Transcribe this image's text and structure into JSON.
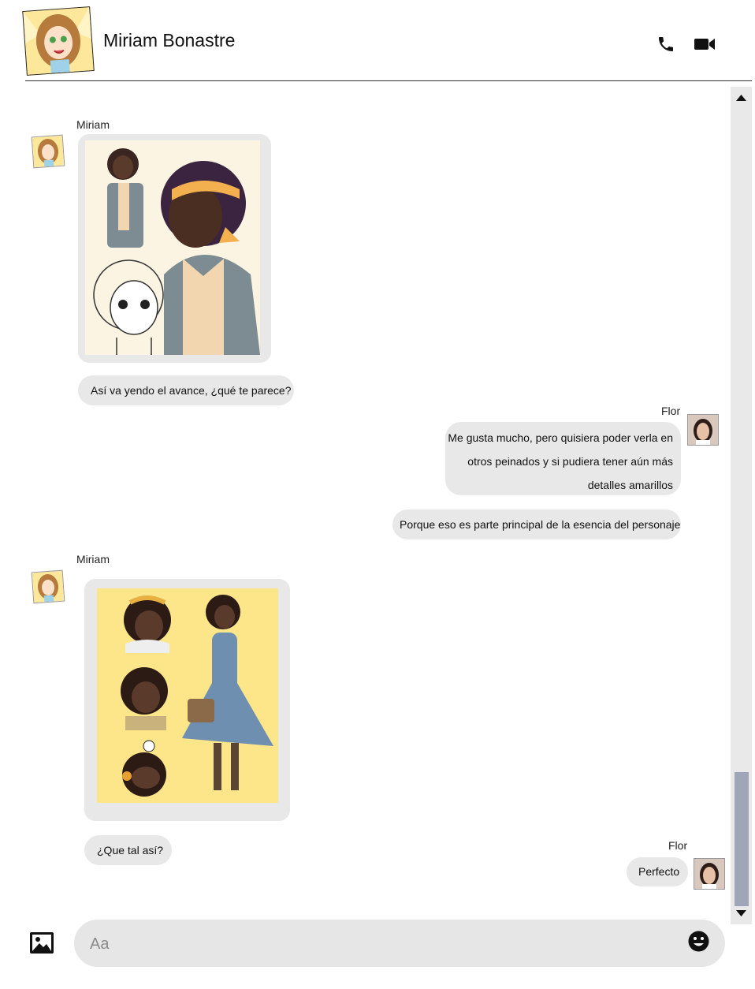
{
  "header": {
    "contact_name": "Miriam Bonastre",
    "call_icon": "phone-icon",
    "video_icon": "video-camera-icon"
  },
  "messages": [
    {
      "sender": "Miriam",
      "type": "image",
      "description_icon": "character-sketch-image"
    },
    {
      "sender": "Miriam",
      "type": "text",
      "text": "Así va yendo el avance, ¿qué te parece?"
    },
    {
      "sender": "Flor",
      "type": "text",
      "lines": [
        "Me gusta mucho, pero quisiera poder verla en",
        "otros peinados y si pudiera tener aún más",
        "detalles amarillos"
      ]
    },
    {
      "sender": "Flor",
      "type": "text",
      "text": "Porque eso es parte principal de la esencia del personaje"
    },
    {
      "sender": "Miriam",
      "type": "image",
      "description_icon": "character-colored-image"
    },
    {
      "sender": "Miriam",
      "type": "text",
      "text": "¿Que tal así?"
    },
    {
      "sender": "Flor",
      "type": "text",
      "text": "Perfecto"
    }
  ],
  "composer": {
    "placeholder": "Aa",
    "image_icon": "image-icon",
    "emoji_icon": "emoji-icon"
  },
  "colors": {
    "bubble": "#e8e8e8",
    "scroll_thumb": "#9ea6b8",
    "yellow_accent": "#fde58a"
  }
}
